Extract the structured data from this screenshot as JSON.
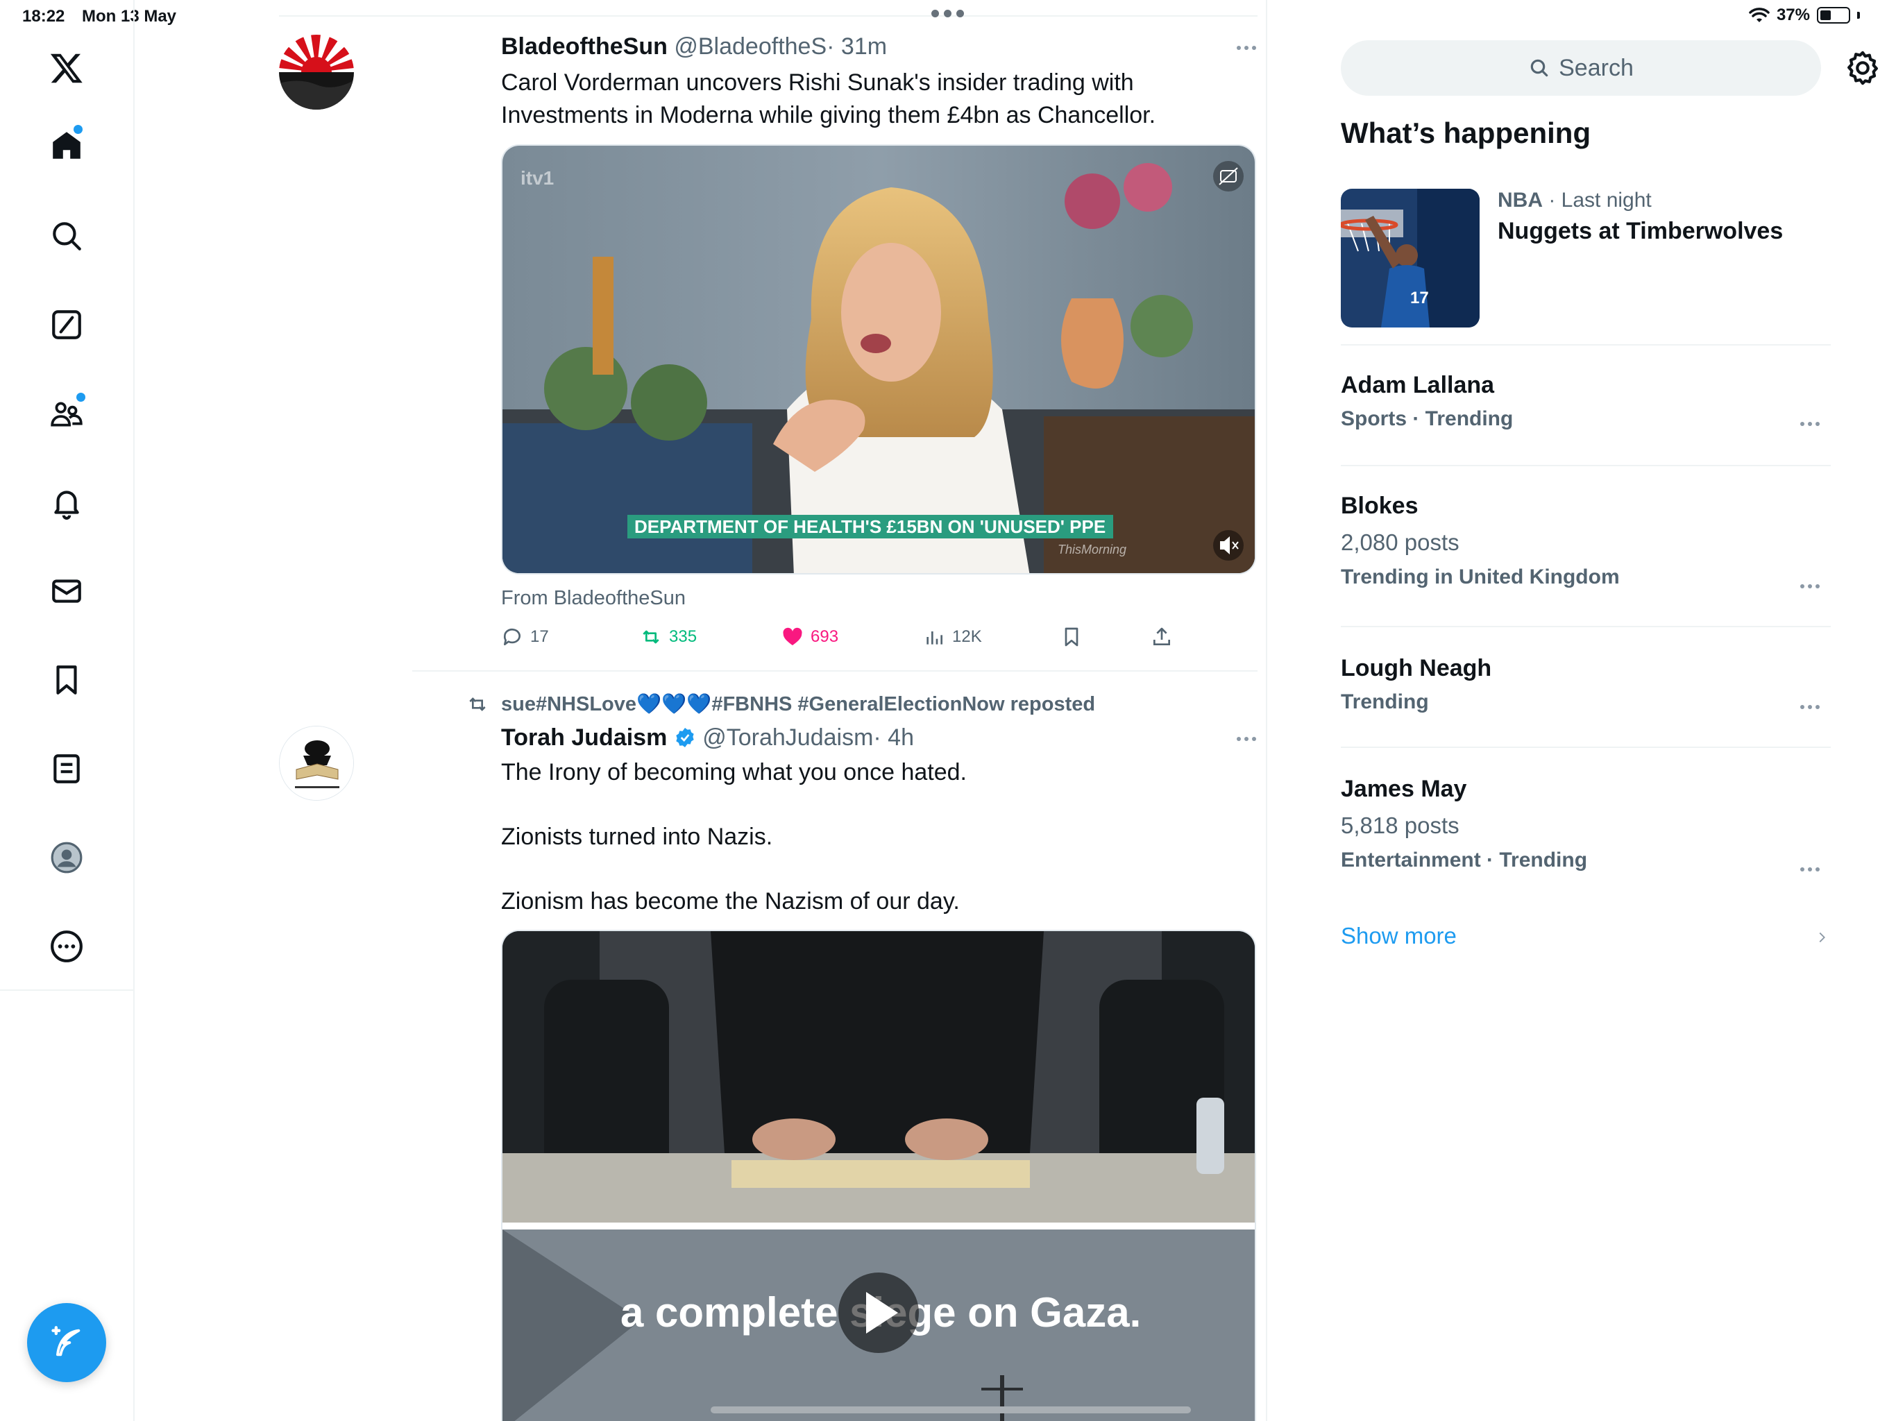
{
  "status_bar": {
    "time": "18:22",
    "date": "Mon 13 May",
    "battery": "37%",
    "battery_level": 0.37
  },
  "sidebar": {
    "items": [
      {
        "name": "x-logo-icon"
      },
      {
        "name": "home-icon",
        "badge": true
      },
      {
        "name": "search-icon"
      },
      {
        "name": "grok-icon"
      },
      {
        "name": "communities-icon",
        "badge": true
      },
      {
        "name": "notifications-icon"
      },
      {
        "name": "messages-icon"
      },
      {
        "name": "bookmarks-icon"
      },
      {
        "name": "lists-icon"
      },
      {
        "name": "profile-icon"
      },
      {
        "name": "more-icon"
      }
    ],
    "compose_icon": "compose-feather-icon"
  },
  "timeline": {
    "posts": [
      {
        "display_name": "BladeoftheSun",
        "handle": "@BladeoftheS",
        "time": "· 31m",
        "text_line1": "Carol Vorderman uncovers Rishi Sunak's insider trading with",
        "text_line2": "Investments in Moderna while giving them £4bn as Chancellor.",
        "media": {
          "watermark": "itv1",
          "caption": "DEPARTMENT OF HEALTH'S £15BN ON 'UNUSED' PPE",
          "show_credit": "ThisMorning"
        },
        "from": "From BladeoftheSun",
        "stats": {
          "replies": "17",
          "reposts": "335",
          "likes": "693",
          "views": "12K"
        }
      },
      {
        "reposted_by": "sue#NHSLove💙💙💙#FBNHS #GeneralElectionNow reposted",
        "display_name": "Torah Judaism",
        "handle": "@TorahJudaism",
        "time": "· 4h",
        "verified": true,
        "text_line1": "The Irony of becoming what you  once hated.",
        "text_line2": "Zionists turned into Nazis.",
        "text_line3": "Zionism has become the Nazism of our day.",
        "media": {
          "subtitle": "a complete siege on Gaza."
        }
      }
    ]
  },
  "right": {
    "search_placeholder": "Search",
    "section_title": "What’s happening",
    "featured": {
      "category": "NBA",
      "time": "· Last night",
      "title": "Nuggets at Timberwolves"
    },
    "trends": [
      {
        "name": "Adam Lallana",
        "meta": "Sports · Trending"
      },
      {
        "name": "Blokes",
        "count": "2,080 posts",
        "meta": "Trending in United Kingdom"
      },
      {
        "name": "Lough Neagh",
        "meta": "Trending"
      },
      {
        "name": "James May",
        "count": "5,818 posts",
        "meta": "Entertainment · Trending"
      }
    ],
    "show_more": "Show more"
  },
  "colors": {
    "accent": "#1d9bf0",
    "repost_green": "#00ba7c",
    "like_pink": "#f91880",
    "text_secondary": "#536471"
  }
}
